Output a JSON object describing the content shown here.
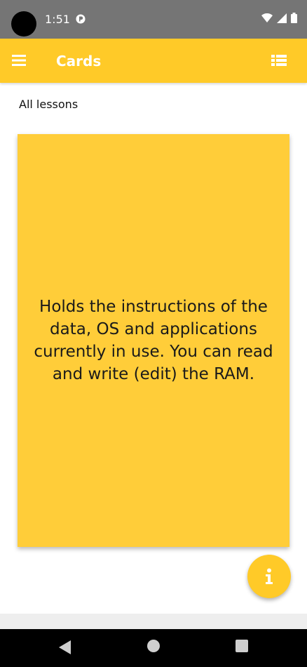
{
  "status_bar": {
    "time": "1:51",
    "icons": [
      "camera-dot",
      "app-notification-icon",
      "wifi-icon",
      "signal-icon",
      "battery-icon"
    ]
  },
  "app_bar": {
    "title": "Cards",
    "menu_icon": "menu-icon",
    "list_icon": "view-list-icon",
    "color": "#FFCA28"
  },
  "lesson": {
    "label": "All lessons"
  },
  "card": {
    "text": "Holds the instructions of the data, OS and applications currently in use. You can read and write (edit) the RAM.",
    "color": "#FFCD39"
  },
  "fab": {
    "icon": "info-icon"
  },
  "nav_bar": {
    "icons": [
      "back-icon",
      "home-icon",
      "recent-apps-icon"
    ]
  }
}
